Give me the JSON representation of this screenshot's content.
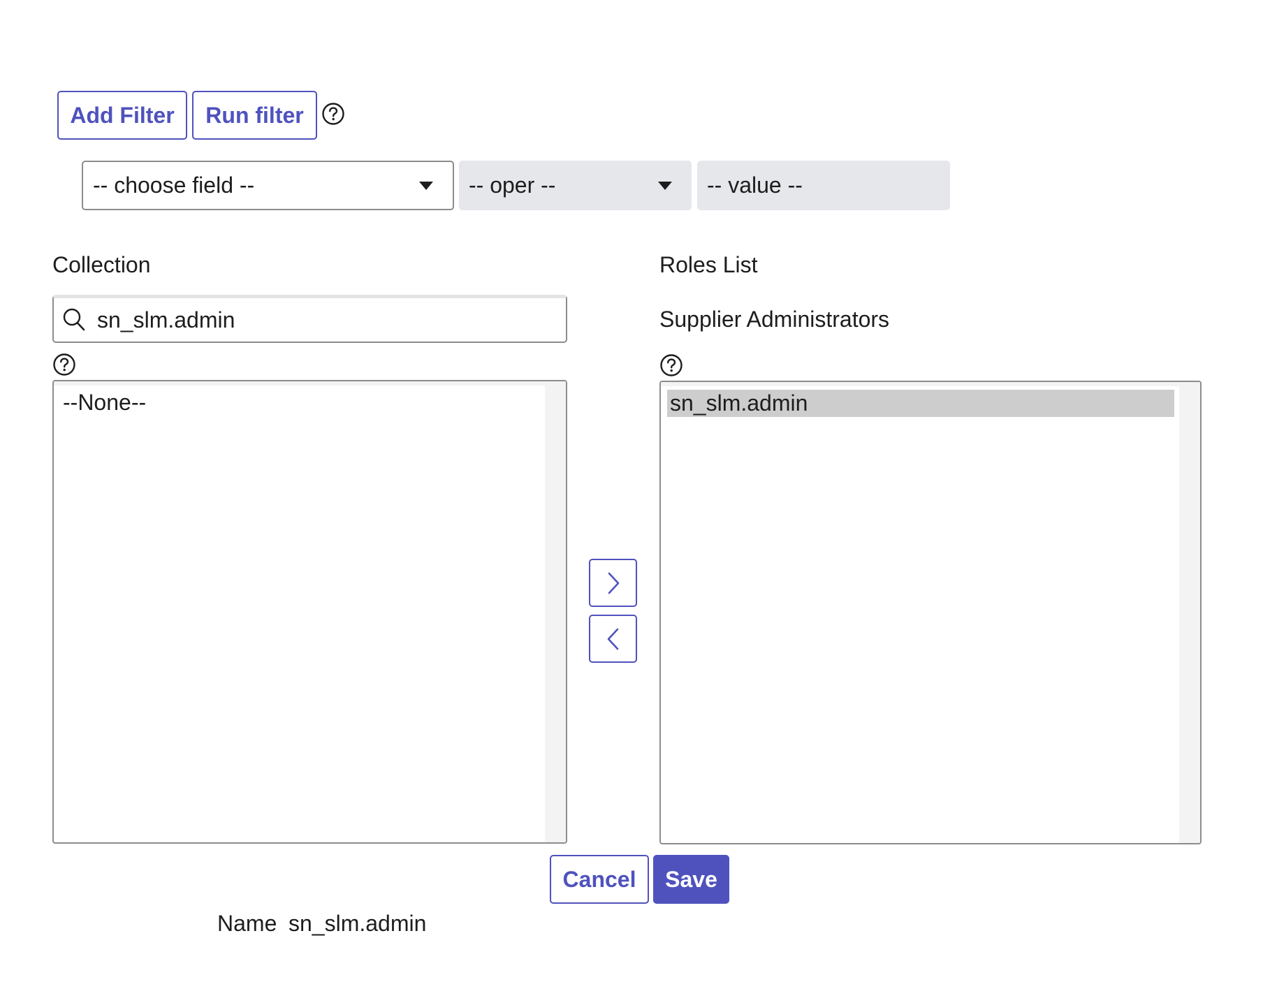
{
  "filter": {
    "add_filter_label": "Add Filter",
    "run_filter_label": "Run filter",
    "choose_field": "-- choose field --",
    "oper": "-- oper --",
    "value": "-- value --"
  },
  "collection": {
    "label": "Collection",
    "search_value": "sn_slm.admin",
    "items": [
      "--None--"
    ]
  },
  "roles": {
    "label": "Roles List",
    "group_label": "Supplier Administrators",
    "items": [
      "sn_slm.admin"
    ]
  },
  "actions": {
    "cancel_label": "Cancel",
    "save_label": "Save"
  },
  "footer": {
    "name_label": "Name",
    "name_value": "sn_slm.admin"
  },
  "colors": {
    "accent": "#4f52bd",
    "selected_item_bg": "#cdcdcd",
    "disabled_field_bg": "#e6e7ea"
  },
  "icons": [
    "help-icon",
    "search-icon",
    "chevron-right-icon",
    "chevron-left-icon",
    "caret-down-icon"
  ]
}
